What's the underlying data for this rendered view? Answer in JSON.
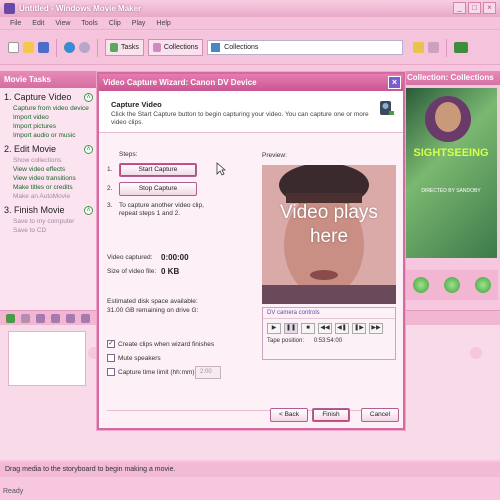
{
  "window": {
    "title": "Untitled - Windows Movie Maker",
    "controls": [
      "_",
      "□",
      "×"
    ]
  },
  "menu": [
    "File",
    "Edit",
    "View",
    "Tools",
    "Clip",
    "Play",
    "Help"
  ],
  "toolbar": {
    "tasks_label": "Tasks",
    "collections_label": "Collections",
    "collections_value": "Collections"
  },
  "task_pane": {
    "header": "Movie Tasks",
    "sections": [
      {
        "title": "1. Capture Video",
        "links": [
          {
            "label": "Capture from video device",
            "disabled": false
          },
          {
            "label": "Import video",
            "disabled": false
          },
          {
            "label": "Import pictures",
            "disabled": false
          },
          {
            "label": "Import audio or music",
            "disabled": false
          }
        ]
      },
      {
        "title": "2. Edit Movie",
        "links": [
          {
            "label": "Show collections",
            "disabled": true
          },
          {
            "label": "View video effects",
            "disabled": false
          },
          {
            "label": "View video transitions",
            "disabled": false
          },
          {
            "label": "Make titles or credits",
            "disabled": false
          },
          {
            "label": "Make an AutoMovie",
            "disabled": true
          }
        ]
      },
      {
        "title": "3. Finish Movie",
        "links": [
          {
            "label": "Save to my computer",
            "disabled": true
          },
          {
            "label": "Save to CD",
            "disabled": true
          }
        ]
      }
    ]
  },
  "collection": {
    "header": "Collection: Collections",
    "thumb_big": "SIGHTSEEING",
    "thumb_small": "DIRECTED BY SANDOBY"
  },
  "wizard": {
    "title": "Video Capture Wizard: Canon DV Device",
    "heading": "Capture Video",
    "description": "Click the Start Capture button to begin capturing your video. You can capture one or more video clips.",
    "steps_label": "Steps:",
    "step1_num": "1.",
    "step2_num": "2.",
    "step3_num": "3.",
    "start_capture": "Start Capture",
    "stop_capture": "Stop Capture",
    "step3_text": "To capture another video clip, repeat steps 1 and 2.",
    "video_captured_label": "Video captured:",
    "video_captured_value": "0:00:00",
    "size_label": "Size of video file:",
    "size_value": "0 KB",
    "disk_label": "Estimated disk space available:",
    "disk_value": "31.00 GB remaining on drive G:",
    "create_clips": "Create clips when wizard finishes",
    "mute_speakers": "Mute speakers",
    "capture_limit": "Capture time limit (hh:mm):",
    "capture_limit_value": "2:00",
    "preview_label": "Preview:",
    "overlay_text": "Video plays here",
    "dv_controls_label": "DV camera controls",
    "dv_buttons": [
      "▶",
      "❚❚",
      "■",
      "◀◀",
      "◀❚",
      "❚▶",
      "▶▶"
    ],
    "tape_label": "Tape position:",
    "tape_value": "0:53:54:00",
    "back": "< Back",
    "finish": "Finish",
    "cancel": "Cancel"
  },
  "drag_hint": "Drag media to the storyboard to begin making a movie.",
  "status": "Ready",
  "colors": {
    "accent": "#d56ea0",
    "link_green": "#17682a",
    "background": "#f6c7df"
  }
}
